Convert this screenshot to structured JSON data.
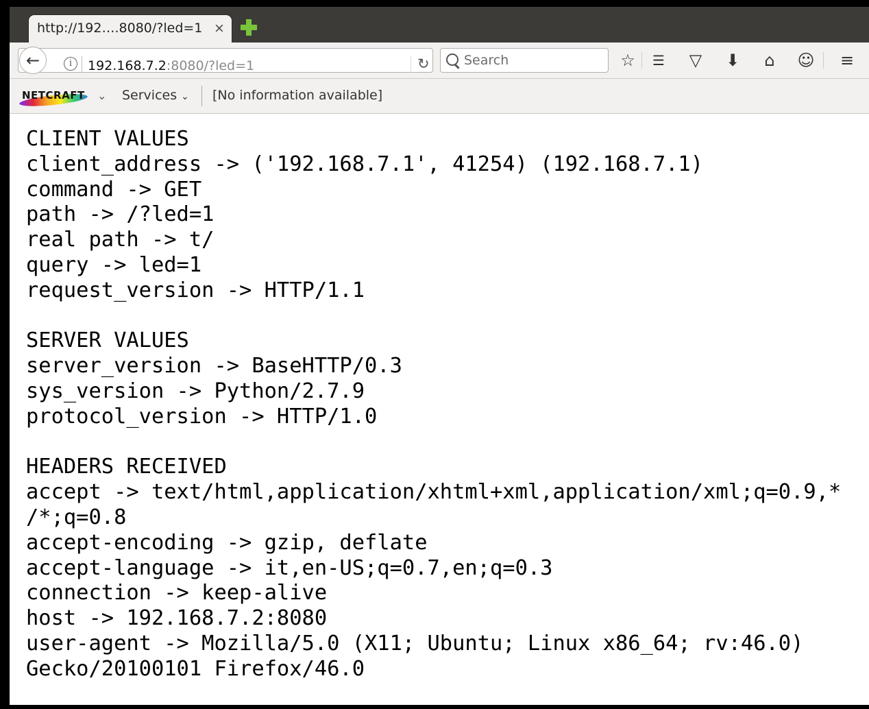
{
  "tab": {
    "title": "http://192….8080/?led=1",
    "close": "×"
  },
  "navbar": {
    "url_host": "192.168.7.2",
    "url_rest": ":8080/?led=1",
    "search_placeholder": "Search"
  },
  "netcraft": {
    "logo": "NETCRAFT",
    "services": "Services",
    "info": "[No information available]"
  },
  "content": {
    "lines": [
      "CLIENT VALUES",
      "client_address -> ('192.168.7.1', 41254) (192.168.7.1)",
      "command -> GET",
      "path -> /?led=1",
      "real path -> t/",
      "query -> led=1",
      "request_version -> HTTP/1.1",
      "",
      "SERVER VALUES",
      "server_version -> BaseHTTP/0.3",
      "sys_version -> Python/2.7.9",
      "protocol_version -> HTTP/1.0",
      "",
      "HEADERS RECEIVED",
      "accept -> text/html,application/xhtml+xml,application/xml;q=0.9,*",
      "/*;q=0.8",
      "accept-encoding -> gzip, deflate",
      "accept-language -> it,en-US;q=0.7,en;q=0.3",
      "connection -> keep-alive",
      "host -> 192.168.7.2:8080",
      "user-agent -> Mozilla/5.0 (X11; Ubuntu; Linux x86_64; rv:46.0)",
      "Gecko/20100101 Firefox/46.0"
    ]
  }
}
